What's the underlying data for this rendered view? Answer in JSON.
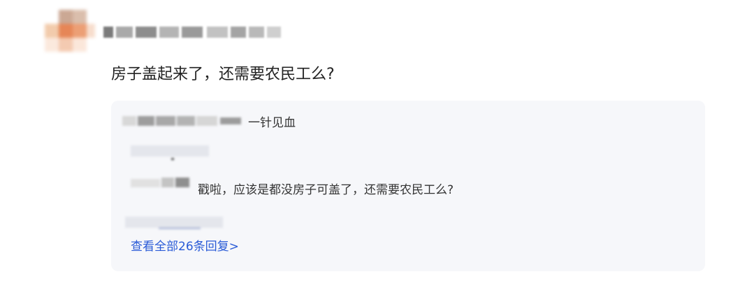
{
  "comment": {
    "text": "房子盖起来了，还需要农民工么?"
  },
  "replies": [
    {
      "text": "一针见血"
    },
    {
      "text": "戳啦，应该是都没房子可盖了，还需要农民工么?"
    }
  ],
  "view_all_label": "查看全部26条回复>",
  "colors": {
    "link": "#2a5bd7",
    "reply_bg": "#f6f7fa",
    "text": "#222222"
  }
}
